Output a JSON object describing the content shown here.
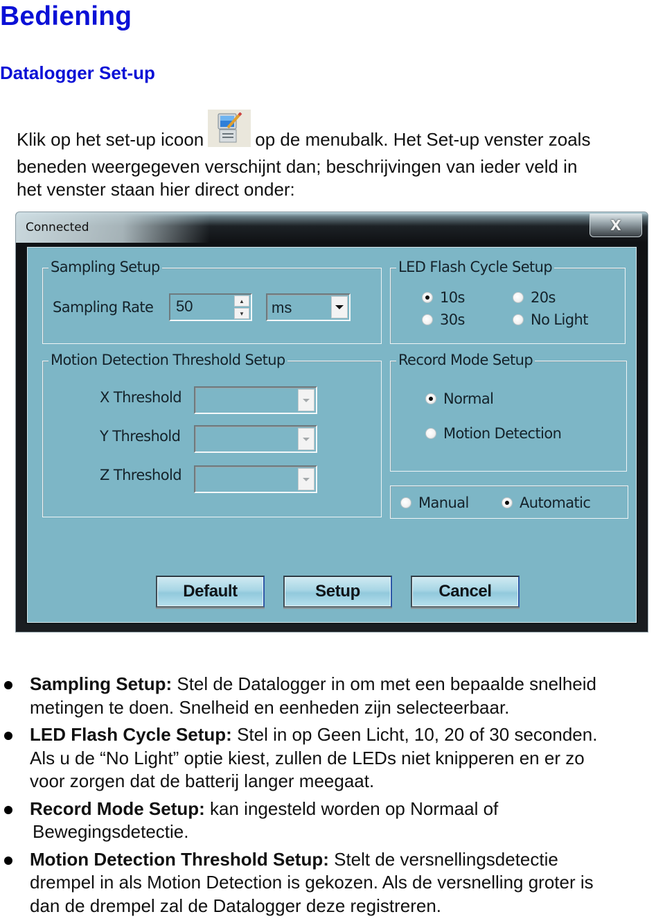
{
  "heading": "Bediening",
  "subheading": "Datalogger Set-up",
  "intro": {
    "before_icon": "Klik op het set-up icoon",
    "icon": "setup-computer-pencil-icon",
    "after_icon": "op de menubalk. Het Set-up venster zoals",
    "line2": "beneden weergegeven verschijnt dan; beschrijvingen van ieder veld in",
    "line3": "het venster staan hier direct onder:"
  },
  "dialog": {
    "title": "Connected",
    "close_label": "X",
    "sampling": {
      "group_label": "Sampling Setup",
      "rate_label": "Sampling Rate",
      "rate_value": "50",
      "unit_value": "ms"
    },
    "led": {
      "group_label": "LED Flash Cycle Setup",
      "options": [
        {
          "label": "10s",
          "selected": true
        },
        {
          "label": "20s",
          "selected": false
        },
        {
          "label": "30s",
          "selected": false
        },
        {
          "label": "No Light",
          "selected": false
        }
      ]
    },
    "motion": {
      "group_label": "Motion Detection Threshold Setup",
      "x_label": "X Threshold",
      "y_label": "Y Threshold",
      "z_label": "Z Threshold",
      "x_value": "",
      "y_value": "",
      "z_value": ""
    },
    "record": {
      "group_label": "Record Mode Setup",
      "options": [
        {
          "label": "Normal",
          "selected": true
        },
        {
          "label": "Motion Detection",
          "selected": false
        }
      ]
    },
    "start": {
      "options": [
        {
          "label": "Manual",
          "selected": false
        },
        {
          "label": "Automatic",
          "selected": true
        }
      ]
    },
    "buttons": {
      "default": "Default",
      "setup": "Setup",
      "cancel": "Cancel"
    },
    "colors": {
      "client_bg": "#7db6c6",
      "frame": "#0f1114"
    }
  },
  "bullets": [
    {
      "term": "Sampling Setup:",
      "line1": " Stel de Datalogger in om met een bepaalde snelheid",
      "line2": "metingen te doen. Snelheid en eenheden zijn selecteerbaar."
    },
    {
      "term": "LED Flash Cycle Setup:",
      "line1": " Stel in op Geen Licht, 10, 20 of 30 seconden.",
      "line2": "Als u de “No Light” optie kiest, zullen de LEDs niet knipperen en er zo",
      "line3": "voor zorgen dat de batterij langer meegaat."
    },
    {
      "term": "Record Mode Setup:",
      "line1": " kan ingesteld worden op Normaal of",
      "line2": "Bewegingsdetectie."
    },
    {
      "term": "Motion Detection Threshold Setup:",
      "line1": " Stelt de versnellingsdetectie",
      "line2": "drempel in als Motion Detection is gekozen. Als de versnelling groter is",
      "line3": "dan de drempel zal de Datalogger deze registreren."
    }
  ],
  "colors": {
    "heading": "#0a10d6"
  }
}
